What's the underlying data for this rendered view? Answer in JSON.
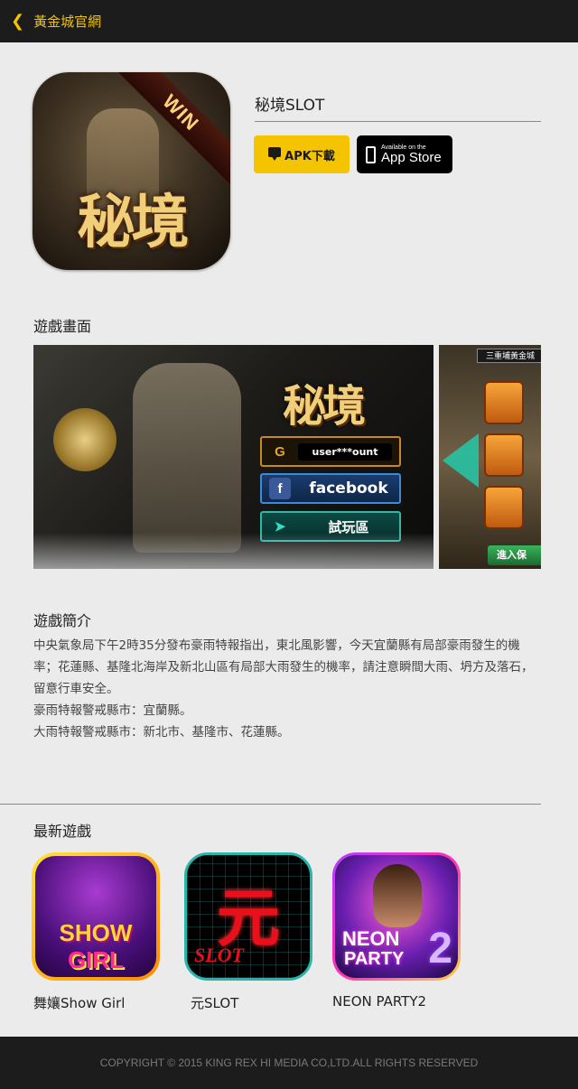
{
  "header": {
    "back_icon": "chevron-left-icon",
    "title": "黃金城官網",
    "accent_color": "#f3c300"
  },
  "app": {
    "name": "秘境SLOT",
    "icon_ribbon_text": "WIN",
    "icon_logo_text": "秘境",
    "apk_button_label": "APK下載",
    "appstore_small": "Available on the",
    "appstore_big": "App Store"
  },
  "screenshots": {
    "title": "遊戲畫面",
    "shot1": {
      "logo_text": "秘境",
      "login_value": "user***ount",
      "login_icon_glyph": "G",
      "facebook_label": "facebook",
      "facebook_icon_glyph": "f",
      "trial_label": "試玩區",
      "trial_icon_glyph": "➤"
    },
    "shot2": {
      "tab_label": "三重埔黃金城",
      "enter_label": "進入保"
    }
  },
  "intro": {
    "title": "遊戲簡介",
    "paragraphs": [
      "中央氣象局下午2時35分發布豪雨特報指出，東北風影響，今天宜蘭縣有局部豪雨發生的機率；花蓮縣、基隆北海岸及新北山區有局部大雨發生的機率，請注意瞬間大雨、坍方及落石，留意行車安全。",
      "豪雨特報警戒縣市：宜蘭縣。",
      "大雨特報警戒縣市：新北市、基隆市、花蓮縣。"
    ]
  },
  "latest": {
    "title": "最新遊戲",
    "games": [
      {
        "label": "舞孃Show Girl",
        "art_top": "SHOW",
        "art_bottom": "GIRL"
      },
      {
        "label": "元SLOT",
        "art_glyph": "元",
        "art_word": "SLOT"
      },
      {
        "label": "NEON PARTY2",
        "art_top": "NEON",
        "art_bottom": "PARTY",
        "art_num": "2"
      }
    ]
  },
  "footer": {
    "copyright": "COPYRIGHT © 2015 KING REX HI MEDIA CO,LTD.ALL RIGHTS RESERVED"
  }
}
